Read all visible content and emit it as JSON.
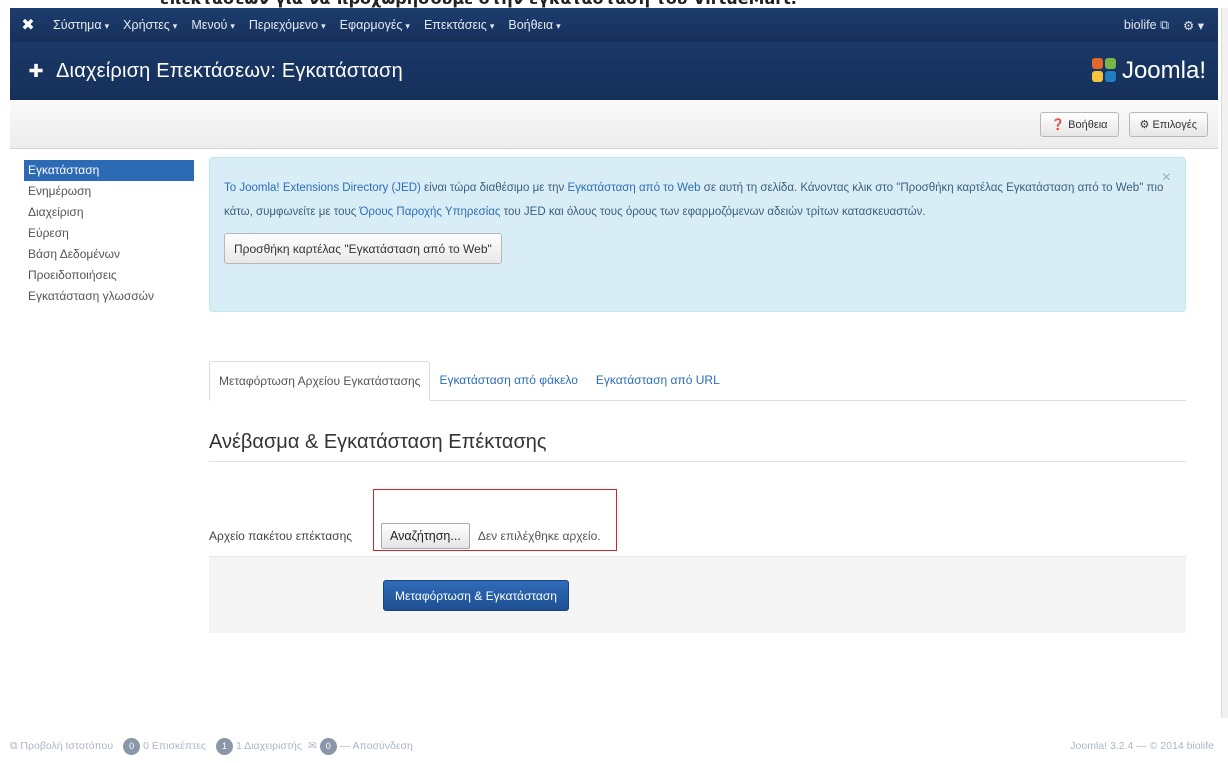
{
  "caption": "επεκτάσεων για να προχωρήσουμε στην εγκατάσταση του VirtueMart.",
  "topnav": {
    "menu": [
      {
        "label": "Σύστημα"
      },
      {
        "label": "Χρήστες"
      },
      {
        "label": "Μενού"
      },
      {
        "label": "Περιεχόμενο"
      },
      {
        "label": "Εφαρμογές"
      },
      {
        "label": "Επεκτάσεις"
      },
      {
        "label": "Βοήθεια"
      }
    ],
    "user": "biolife",
    "external_icon": "external-link-icon",
    "settings_icon": "gear-icon"
  },
  "header": {
    "title": "Διαχείριση Επεκτάσεων: Εγκατάσταση",
    "icon": "puzzle-icon",
    "brand": "Joomla!"
  },
  "toolbar": {
    "help": "Βοήθεια",
    "options": "Επιλογές"
  },
  "sidebar": {
    "items": [
      {
        "label": "Εγκατάσταση"
      },
      {
        "label": "Ενημέρωση"
      },
      {
        "label": "Διαχείριση"
      },
      {
        "label": "Εύρεση"
      },
      {
        "label": "Βάση Δεδομένων"
      },
      {
        "label": "Προειδοποιήσεις"
      },
      {
        "label": "Εγκατάσταση γλωσσών"
      }
    ]
  },
  "alert": {
    "jed_link": "Το Joomla! Extensions Directory (JED)",
    "t1": " είναι τώρα διαθέσιμο με την ",
    "web_link": "Εγκατάσταση από το Web",
    "t2": " σε αυτή τη σελίδα.  Κάνοντας κλικ στο \"Προσθήκη καρτέλας Εγκατάσταση από το Web\" πιο κάτω, συμφωνείτε με τους ",
    "tos_link": "Όρους Παροχής Υπηρεσίας",
    "t3": " του JED και όλους τους όρους των εφαρμοζόμενων αδειών τρίτων κατασκευαστών.",
    "button": "Προσθήκη καρτέλας \"Εγκατάσταση από το Web\"",
    "close": "×"
  },
  "tabs": [
    {
      "label": "Μεταφόρτωση Αρχείου Εγκατάστασης"
    },
    {
      "label": "Εγκατάσταση από φάκελο"
    },
    {
      "label": "Εγκατάσταση από URL"
    }
  ],
  "section_title": "Ανέβασμα & Εγκατάσταση Επέκτασης",
  "file": {
    "label": "Αρχείο πακέτου επέκτασης",
    "browse": "Αναζήτηση...",
    "none": "Δεν επιλέχθηκε αρχείο."
  },
  "submit": "Μεταφόρτωση & Εγκατάσταση",
  "footer": {
    "preview": "Προβολή Ιστοτόπου",
    "visitors_count": "0",
    "visitors": "0 Επισκέπτες",
    "admins_count": "1",
    "admins": "1 Διαχειριστής",
    "messages_count": "0",
    "logout": "— Αποσύνδεση",
    "version": "Joomla! 3.2.4 — © 2014 biolife"
  }
}
